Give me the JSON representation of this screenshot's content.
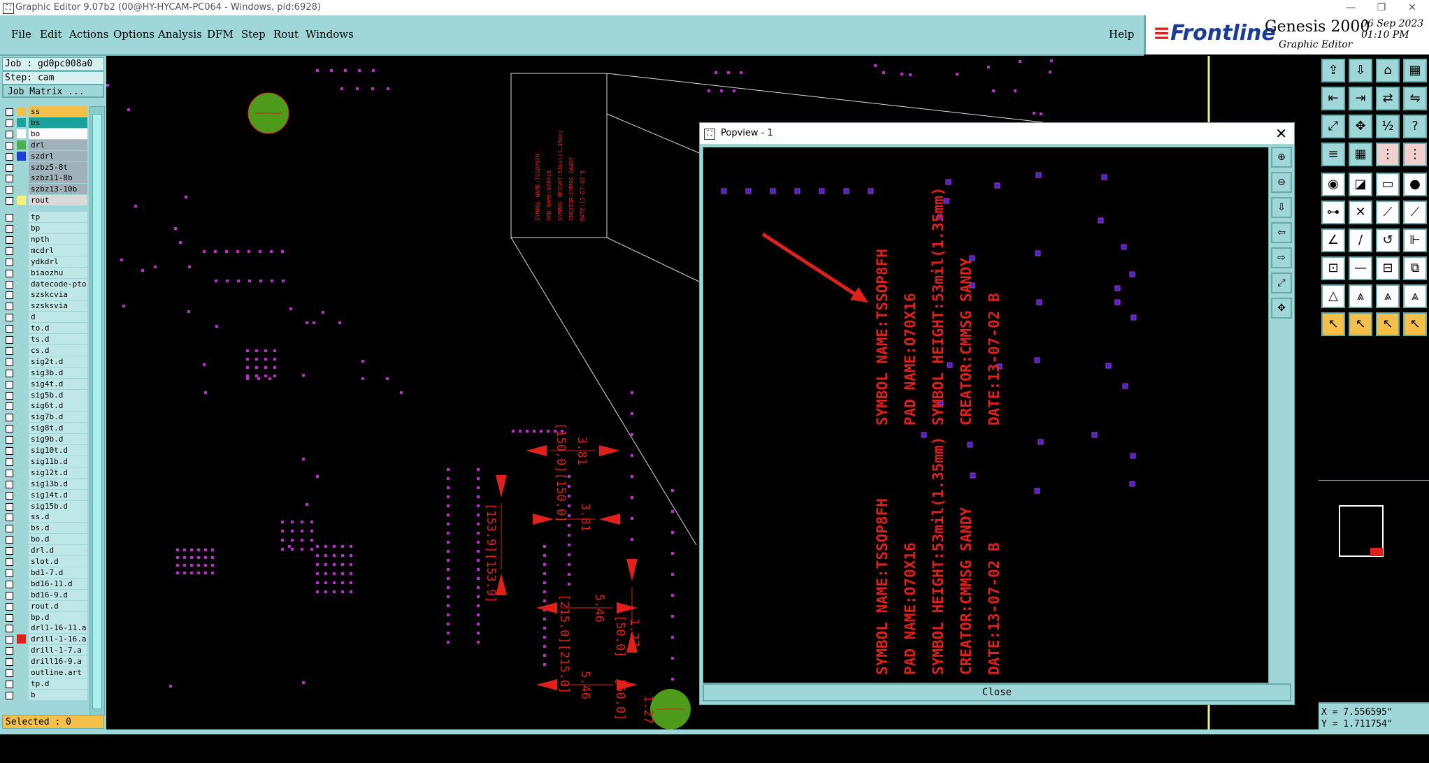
{
  "window": {
    "title": "Graphic Editor 9.07b2 (00@HY-HYCAM-PC064 - Windows, pid:6928)",
    "min_icon": "minimize-icon",
    "max_icon": "restore-icon",
    "close_icon": "close-icon"
  },
  "menu": {
    "items": [
      "File",
      "Edit",
      "Actions",
      "Options",
      "Analysis",
      "DFM",
      "Step",
      "Rout",
      "Windows"
    ],
    "help": "Help"
  },
  "brand": {
    "logo": "Frontline",
    "product": "Genesis 2000",
    "subtitle": "Graphic Editor",
    "date": "06 Sep 2023",
    "time": "01:10 PM"
  },
  "job": {
    "job_line": "Job : gd0pc008a0",
    "step_line": "Step: cam",
    "matrix_button": "Job Matrix ..."
  },
  "layers": [
    {
      "name": "ss",
      "color": "#f5c04a",
      "name_bg": "#f5c04a"
    },
    {
      "name": "bs",
      "color": "#1aa39a",
      "name_bg": "#1aa39a"
    },
    {
      "name": "bo",
      "color": "#ffffff",
      "name_bg": "#ffffff"
    },
    {
      "name": "drl",
      "color": "#4caf50",
      "name_bg": "#9fb2bb"
    },
    {
      "name": "szdrl",
      "color": "#1e3fd6",
      "name_bg": "#9fb2bb"
    },
    {
      "name": "szbz5-8t",
      "color": "",
      "name_bg": "#9fb2bb"
    },
    {
      "name": "szbz11-8b",
      "color": "",
      "name_bg": "#9fb2bb"
    },
    {
      "name": "szbz13-10b",
      "color": "",
      "name_bg": "#9fb2bb"
    },
    {
      "name": "rout",
      "color": "#f4f17a",
      "name_bg": "#d9d9d9"
    },
    {
      "name": "tp",
      "color": "",
      "name_bg": ""
    },
    {
      "name": "bp",
      "color": "",
      "name_bg": ""
    },
    {
      "name": "npth",
      "color": "",
      "name_bg": ""
    },
    {
      "name": "mcdrl",
      "color": "",
      "name_bg": ""
    },
    {
      "name": "ydkdrl",
      "color": "",
      "name_bg": ""
    },
    {
      "name": "biaozhu",
      "color": "",
      "name_bg": ""
    },
    {
      "name": "datecode-pto",
      "color": "",
      "name_bg": ""
    },
    {
      "name": "szskcvia",
      "color": "",
      "name_bg": ""
    },
    {
      "name": "szsksvia",
      "color": "",
      "name_bg": ""
    },
    {
      "name": "d",
      "color": "",
      "name_bg": ""
    },
    {
      "name": "to.d",
      "color": "",
      "name_bg": ""
    },
    {
      "name": "ts.d",
      "color": "",
      "name_bg": ""
    },
    {
      "name": "cs.d",
      "color": "",
      "name_bg": ""
    },
    {
      "name": "sig2t.d",
      "color": "",
      "name_bg": ""
    },
    {
      "name": "sig3b.d",
      "color": "",
      "name_bg": ""
    },
    {
      "name": "sig4t.d",
      "color": "",
      "name_bg": ""
    },
    {
      "name": "sig5b.d",
      "color": "",
      "name_bg": ""
    },
    {
      "name": "sig6t.d",
      "color": "",
      "name_bg": ""
    },
    {
      "name": "sig7b.d",
      "color": "",
      "name_bg": ""
    },
    {
      "name": "sig8t.d",
      "color": "",
      "name_bg": ""
    },
    {
      "name": "sig9b.d",
      "color": "",
      "name_bg": ""
    },
    {
      "name": "sig10t.d",
      "color": "",
      "name_bg": ""
    },
    {
      "name": "sig11b.d",
      "color": "",
      "name_bg": ""
    },
    {
      "name": "sig12t.d",
      "color": "",
      "name_bg": ""
    },
    {
      "name": "sig13b.d",
      "color": "",
      "name_bg": ""
    },
    {
      "name": "sig14t.d",
      "color": "",
      "name_bg": ""
    },
    {
      "name": "sig15b.d",
      "color": "",
      "name_bg": ""
    },
    {
      "name": "ss.d",
      "color": "",
      "name_bg": ""
    },
    {
      "name": "bs.d",
      "color": "",
      "name_bg": ""
    },
    {
      "name": "bo.d",
      "color": "",
      "name_bg": ""
    },
    {
      "name": "drl.d",
      "color": "",
      "name_bg": ""
    },
    {
      "name": "slot.d",
      "color": "",
      "name_bg": ""
    },
    {
      "name": "bd1-7.d",
      "color": "",
      "name_bg": ""
    },
    {
      "name": "bd16-11.d",
      "color": "",
      "name_bg": ""
    },
    {
      "name": "bd16-9.d",
      "color": "",
      "name_bg": ""
    },
    {
      "name": "rout.d",
      "color": "",
      "name_bg": ""
    },
    {
      "name": "bp.d",
      "color": "",
      "name_bg": ""
    },
    {
      "name": "drl1-16-11.a",
      "color": "",
      "name_bg": ""
    },
    {
      "name": "drill-1-16.a",
      "color": "#e0201a",
      "name_bg": ""
    },
    {
      "name": "drill-1-7.a",
      "color": "",
      "name_bg": ""
    },
    {
      "name": "drill16-9.a",
      "color": "",
      "name_bg": ""
    },
    {
      "name": "outline.art",
      "color": "",
      "name_bg": ""
    },
    {
      "name": "tp.d",
      "color": "",
      "name_bg": ""
    },
    {
      "name": "b",
      "color": "",
      "name_bg": ""
    }
  ],
  "status": {
    "selected": "Selected : 0",
    "x": "X = 7.556595\"",
    "y": "Y = 1.711754\""
  },
  "canvas": {
    "zoom_text_1": "SYMBOL NAME:TSSOP8FH",
    "zoom_text_2": "PAD NAME:O70X16",
    "zoom_text_3": "SYMBOL HEIGHT:53mil(1.35mm)",
    "zoom_text_4": "CREATOR:CMMSG SANDY",
    "zoom_text_5": "DATE:13-07-02 B",
    "dims": [
      "3.81",
      "3.81",
      "[150.0][150.0]",
      "[153.9][153.9]",
      "5.46",
      "[215.0][215.0]",
      "5.46",
      "[50.0]",
      "[50.0]",
      "1.27",
      "1.27"
    ]
  },
  "popview": {
    "title": "Popview - 1",
    "close_label": "Close",
    "text_block_a": [
      "SYMBOL NAME:TSSOP8FH",
      "PAD NAME:O70X16",
      "SYMBOL HEIGHT:53mil(1.35mm)",
      "CREATOR:CMMSG SANDY",
      "DATE:13-07-02 B"
    ],
    "text_block_b": [
      "SYMBOL NAME:TSSOP8FH",
      "PAD NAME:O70X16",
      "SYMBOL HEIGHT:53mil(1.35mm)",
      "CREATOR:CMMSG SANDY",
      "DATE:13-07-02 B"
    ]
  },
  "colors": {
    "panel": "#9fd7d9",
    "pad_magenta": "#c02ad0",
    "pad_blue": "#3a2cc8",
    "annotation_red": "#e0201a",
    "drill_green": "#4e9a1a"
  }
}
